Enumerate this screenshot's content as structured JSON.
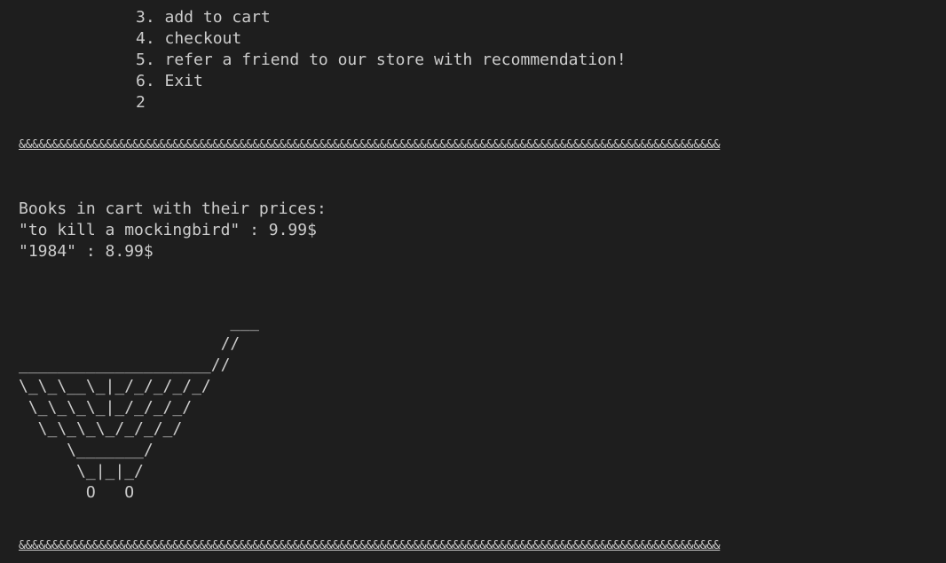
{
  "terminal": {
    "menu": [
      "3. add to cart",
      "4. checkout",
      "5. refer a friend to our store with recommendation!",
      "6. Exit"
    ],
    "user_input": "2",
    "separator_top": "&&&&&&&&&&&&&&&&&&&&&&&&&&&&&&&&&&&&&&&&&&&&&&&&&&&&&&&&&&&&&&&&&&&&&&&&&&&&&&&&&&&&&&&&&&&&&&&&&&&&&&&&&",
    "cart_heading": "Books in cart with their prices:",
    "cart_items": [
      "\"to kill a mockingbird\" : 9.99$",
      "\"1984\" : 8.99$"
    ],
    "cart_art": "                      ___\n                     //\n____________________//\n\\_\\_\\__\\_|_/_/_/_/_/\n \\_\\_\\_\\_|_/_/_/_/\n  \\_\\_\\_\\_/_/_/_/\n     \\_______/\n      \\_|_|_/\n       O   O",
    "separator_bottom": "&&&&&&&&&&&&&&&&&&&&&&&&&&&&&&&&&&&&&&&&&&&&&&&&&&&&&&&&&&&&&&&&&&&&&&&&&&&&&&&&&&&&&&&&&&&&&&&&&&&&&&&&&"
  }
}
